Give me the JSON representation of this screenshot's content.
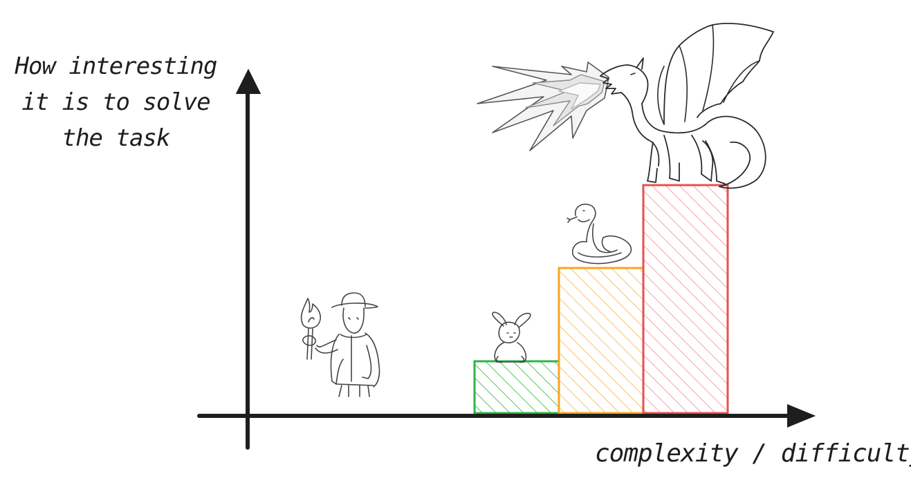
{
  "y_axis_label_lines": [
    "How interesting",
    "it is to solve",
    "the task"
  ],
  "x_axis_label": "complexity / difficulty",
  "chart_data": {
    "type": "bar",
    "xlabel": "complexity / difficulty",
    "ylabel": "How interesting it is to solve the task",
    "categories": [
      "",
      "",
      ""
    ],
    "values": [
      1.0,
      2.8,
      4.4
    ],
    "ylim": [
      0,
      7
    ],
    "bar_colors": [
      "#2fb344",
      "#f5a623",
      "#e85050"
    ],
    "bar_fill_colors": [
      "#52c75e",
      "#fbc266",
      "#f5a3a3"
    ],
    "bar_characters": [
      "rabbit-icon",
      "snake-icon",
      "dragon-icon"
    ],
    "figure_near_origin": "explorer-with-torch-icon",
    "grid": false,
    "legend": "none"
  }
}
